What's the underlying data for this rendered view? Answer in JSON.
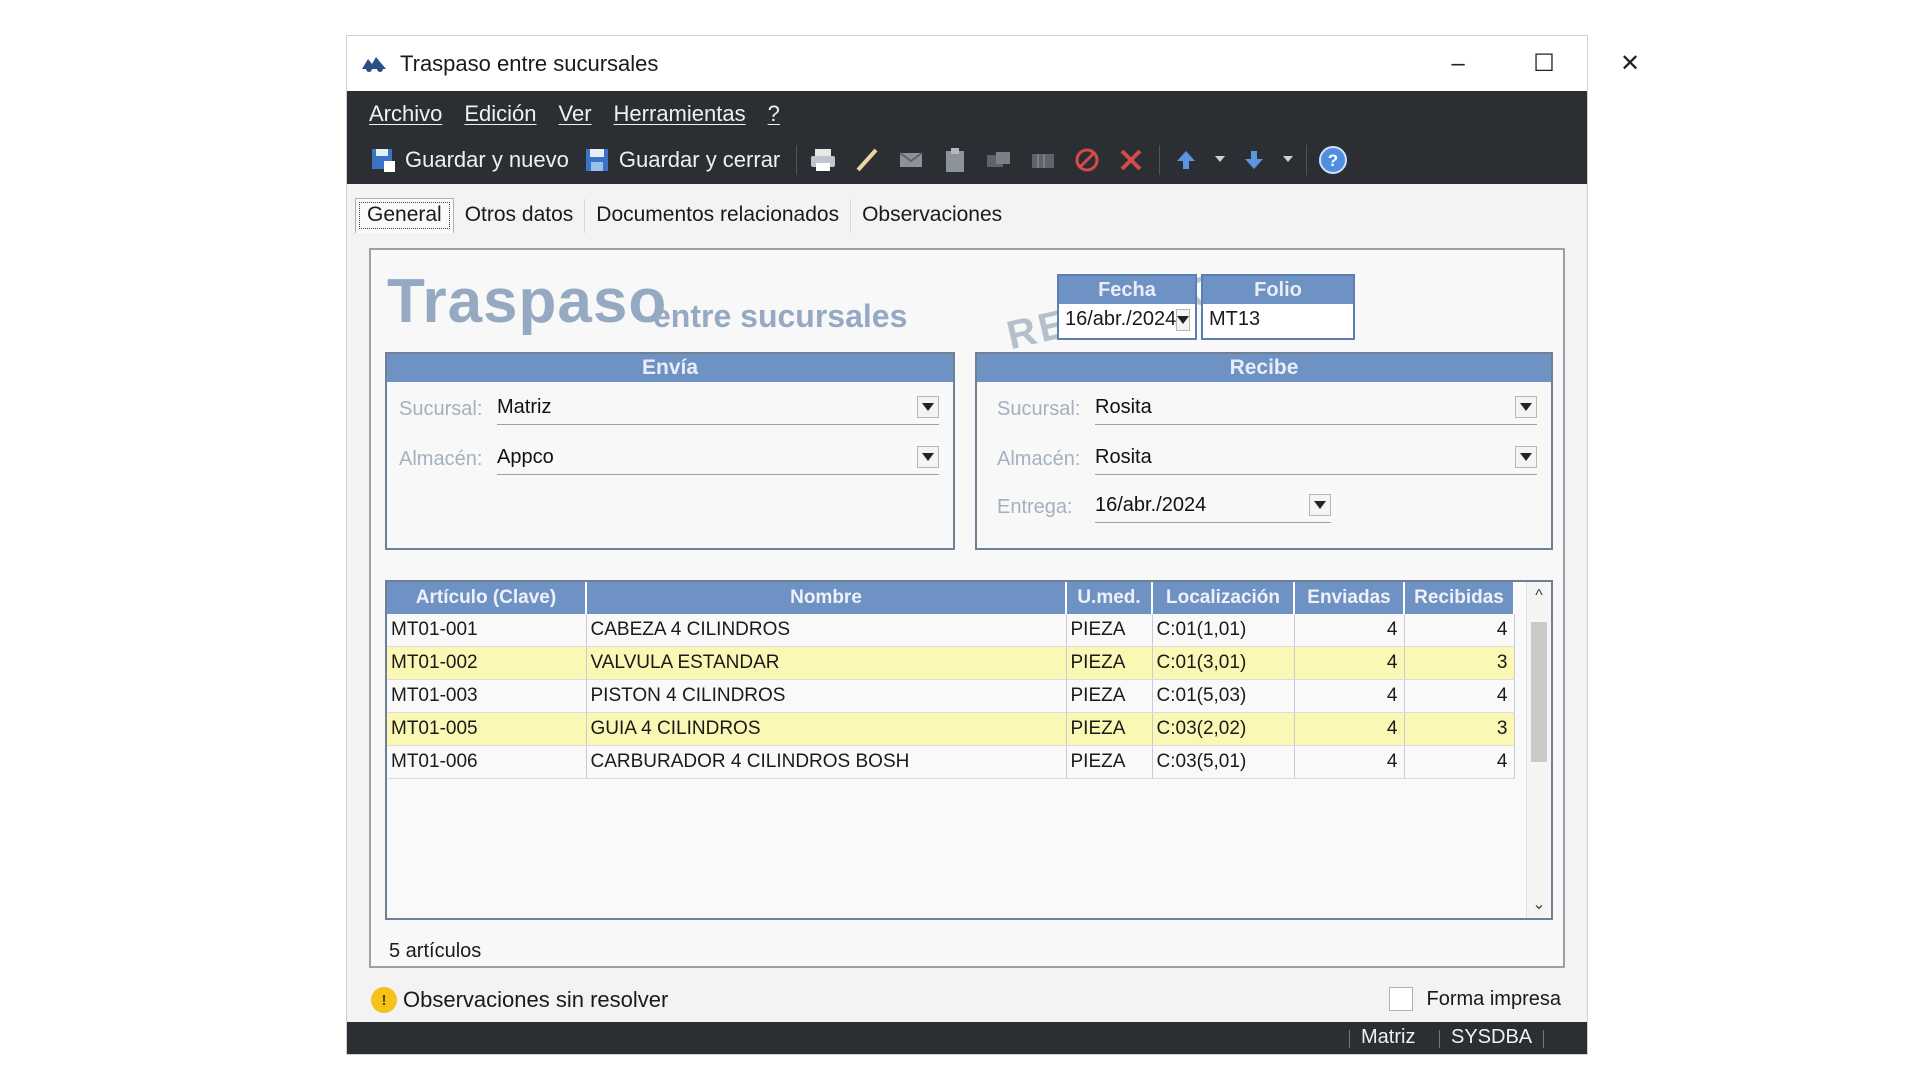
{
  "window": {
    "title": "Traspaso entre sucursales",
    "controls": [
      "minimize-icon",
      "maximize-icon",
      "close-icon"
    ]
  },
  "menu": [
    "Archivo",
    "Edición",
    "Ver",
    "Herramientas",
    "?"
  ],
  "toolbar": {
    "save_new_label": "Guardar y nuevo",
    "save_close_label": "Guardar y cerrar",
    "icons": [
      "print-icon",
      "edit-icon",
      "mail-icon",
      "clipboard-icon",
      "disabled-icon",
      "disabled-icon",
      "cancel-icon",
      "delete-icon",
      "arrow-up-icon",
      "arrow-down-icon",
      "help-icon"
    ]
  },
  "tabs": [
    "General",
    "Otros datos",
    "Documentos relacionados",
    "Observaciones"
  ],
  "header": {
    "title": "Traspaso",
    "subtitle": "entre sucursales",
    "stamp": "RECIBIDO",
    "fecha_label": "Fecha",
    "fecha_value": "16/abr./2024",
    "folio_label": "Folio",
    "folio_value": "MT13"
  },
  "envia": {
    "caption": "Envía",
    "sucursal_label": "Sucursal:",
    "sucursal_value": "Matriz",
    "almacen_label": "Almacén:",
    "almacen_value": "Appco"
  },
  "recibe": {
    "caption": "Recibe",
    "sucursal_label": "Sucursal:",
    "sucursal_value": "Rosita",
    "almacen_label": "Almacén:",
    "almacen_value": "Rosita",
    "entrega_label": "Entrega:",
    "entrega_value": "16/abr./2024"
  },
  "grid": {
    "columns": [
      "Artículo (Clave)",
      "Nombre",
      "U.med.",
      "Localización",
      "Enviadas",
      "Recibidas"
    ],
    "rows": [
      {
        "clave": "MT01-001",
        "nombre": "CABEZA 4 CILINDROS",
        "umed": "PIEZA",
        "loc": "C:01(1,01)",
        "enviadas": "4",
        "recibidas": "4",
        "highlight": false
      },
      {
        "clave": "MT01-002",
        "nombre": "VALVULA ESTANDAR",
        "umed": "PIEZA",
        "loc": "C:01(3,01)",
        "enviadas": "4",
        "recibidas": "3",
        "highlight": true
      },
      {
        "clave": "MT01-003",
        "nombre": "PISTON 4 CILINDROS",
        "umed": "PIEZA",
        "loc": "C:01(5,03)",
        "enviadas": "4",
        "recibidas": "4",
        "highlight": false
      },
      {
        "clave": "MT01-005",
        "nombre": "GUIA 4 CILINDROS",
        "umed": "PIEZA",
        "loc": "C:03(2,02)",
        "enviadas": "4",
        "recibidas": "3",
        "highlight": true
      },
      {
        "clave": "MT01-006",
        "nombre": "CARBURADOR 4 CILINDROS BOSH",
        "umed": "PIEZA",
        "loc": "C:03(5,01)",
        "enviadas": "4",
        "recibidas": "4",
        "highlight": false
      }
    ],
    "count_label": "5 artículos"
  },
  "footer": {
    "warning": "Observaciones sin resolver",
    "printed_form_label": "Forma impresa",
    "printed_form_checked": false
  },
  "statusbar": {
    "branch": "Matriz",
    "user": "SYSDBA"
  },
  "colors": {
    "dark_bar": "#2b2f34",
    "header_blue": "#6f92c4",
    "highlight_row": "#fbf7b4",
    "title_blue": "#96a9c2"
  }
}
